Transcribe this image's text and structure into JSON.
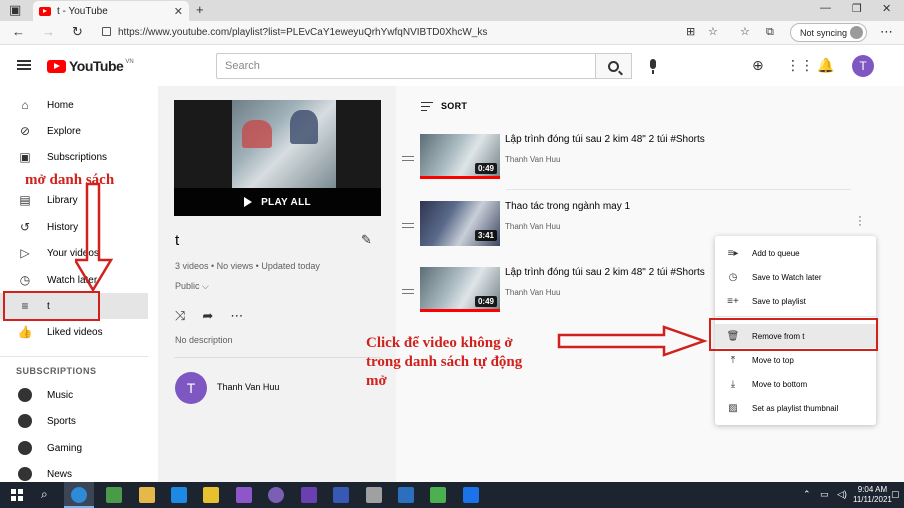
{
  "browser": {
    "tab_title": "t - YouTube",
    "tab_close": "✕",
    "new_tab": "+",
    "url": "https://www.youtube.com/playlist?list=PLEvCaY1eweyuQrhYwfqNVIBTD0XhcW_ks",
    "sync_label": "Not syncing",
    "window_controls": [
      "—",
      "❐",
      "✕"
    ]
  },
  "header": {
    "logo_text": "YouTube",
    "region": "VN",
    "search_placeholder": "Search",
    "avatar_letter": "T"
  },
  "sidebar": {
    "items": [
      {
        "label": "Home",
        "icon": "⌂"
      },
      {
        "label": "Explore",
        "icon": "⊘"
      },
      {
        "label": "Subscriptions",
        "icon": "▣"
      },
      {
        "label": "Library",
        "icon": "▤"
      },
      {
        "label": "History",
        "icon": "↺"
      },
      {
        "label": "Your videos",
        "icon": "▷"
      },
      {
        "label": "Watch later",
        "icon": "◷"
      },
      {
        "label": "t",
        "icon": "≡"
      },
      {
        "label": "Liked videos",
        "icon": "👍"
      }
    ],
    "subscriptions_header": "SUBSCRIPTIONS",
    "subscriptions": [
      {
        "label": "Music"
      },
      {
        "label": "Sports"
      },
      {
        "label": "Gaming"
      },
      {
        "label": "News"
      }
    ]
  },
  "playlist": {
    "play_all": "PLAY ALL",
    "title": "t",
    "stats": "3 videos • No views • Updated today",
    "privacy": "Public",
    "description": "No description",
    "owner_initial": "T",
    "owner_name": "Thanh Van Huu"
  },
  "video_list": {
    "sort_label": "SORT",
    "videos": [
      {
        "title": "Lập trình đóng túi sau 2 kim 48\" 2 túi #Shorts",
        "channel": "Thanh Van Huu",
        "duration": "0:49",
        "watched_fraction": 1.0
      },
      {
        "title": "Thao tác trong ngành may 1",
        "channel": "Thanh Van Huu",
        "duration": "3:41",
        "watched_fraction": 0.0
      },
      {
        "title": "Lập trình đóng túi sau 2 kim 48\" 2 túi #Shorts",
        "channel": "Thanh Van Huu",
        "duration": "0:49",
        "watched_fraction": 1.0
      }
    ]
  },
  "context_menu": {
    "items": [
      {
        "label": "Add to queue",
        "icon": "≡▸"
      },
      {
        "label": "Save to Watch later",
        "icon": "◷"
      },
      {
        "label": "Save to playlist",
        "icon": "≡+"
      },
      {
        "label": "Remove from t",
        "icon": "🗑"
      },
      {
        "label": "Move to top",
        "icon": "⤒"
      },
      {
        "label": "Move to bottom",
        "icon": "⤓"
      },
      {
        "label": "Set as playlist thumbnail",
        "icon": "▨"
      }
    ]
  },
  "annotations": {
    "open_list": "mở danh sách",
    "click_line1": "Click để video không ở",
    "click_line2": "trong danh sách tự động",
    "click_line3": "mở",
    "color": "#d0211c"
  },
  "taskbar": {
    "time": "9:04 AM",
    "date": "11/11/2021"
  }
}
